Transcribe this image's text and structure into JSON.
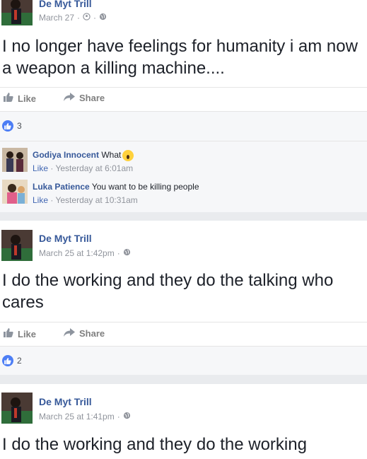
{
  "posts": [
    {
      "author": "De Myt Trill",
      "time": "March 27",
      "text": "I no longer have feelings for humanity i am now a weapon a killing machine....",
      "like_label": "Like",
      "share_label": "Share",
      "reaction_count": "3",
      "comments": [
        {
          "name": "Godiya Innocent",
          "text": "What",
          "like": "Like",
          "time": "Yesterday at 6:01am"
        },
        {
          "name": "Luka Patience",
          "text": "You want to be killing people",
          "like": "Like",
          "time": "Yesterday at 10:31am"
        }
      ]
    },
    {
      "author": "De Myt Trill",
      "time": "March 25 at 1:42pm",
      "text": "I do the working and they do the talking who cares",
      "like_label": "Like",
      "share_label": "Share",
      "reaction_count": "2"
    },
    {
      "author": "De Myt Trill",
      "time": "March 25 at 1:41pm",
      "text": "I do the working and they do the working"
    }
  ],
  "separator": "·",
  "colors": {
    "link": "#365899",
    "reaction": "#4d7ef5",
    "background": "#e9ebee",
    "muted": "#90949c"
  },
  "icons": [
    "thumbs-up-icon",
    "share-arrow-icon",
    "globe-icon",
    "friends-icon",
    "like-reaction-icon",
    "shocked-emoji-icon"
  ]
}
